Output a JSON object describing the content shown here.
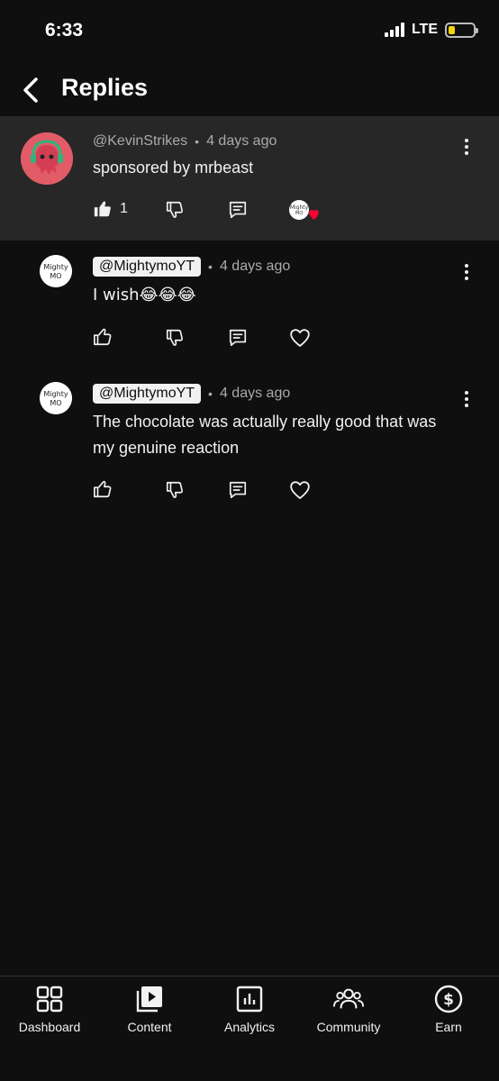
{
  "status_bar": {
    "time": "6:33",
    "network": "LTE",
    "battery_level": 0.25,
    "battery_color": "#f5d30f"
  },
  "header": {
    "back_icon": "chevron-left-icon",
    "title": "Replies"
  },
  "parent_comment": {
    "handle": "@KevinStrikes",
    "separator": "•",
    "time": "4 days ago",
    "text": "sponsored by mrbeast",
    "like_count": "1",
    "liked": true,
    "creator_heart": true
  },
  "replies": [
    {
      "handle": "@MightymoYT",
      "separator": "•",
      "time": "4 days ago",
      "text": "I wish😂😂😂",
      "avatar_text": "Mighty MO"
    },
    {
      "handle": "@MightymoYT",
      "separator": "•",
      "time": "4 days ago",
      "text": "The chocolate was actually really good that was my genuine reaction",
      "avatar_text": "Mighty MO"
    }
  ],
  "bottom_nav": {
    "items": [
      {
        "label": "Dashboard",
        "icon": "dashboard-icon"
      },
      {
        "label": "Content",
        "icon": "content-icon"
      },
      {
        "label": "Analytics",
        "icon": "analytics-icon"
      },
      {
        "label": "Community",
        "icon": "community-icon"
      },
      {
        "label": "Earn",
        "icon": "earn-icon"
      }
    ]
  },
  "colors": {
    "background": "#0f0f0f",
    "parent_highlight": "#272727",
    "text_primary": "#f1f1f1",
    "text_secondary": "#aaaaaa",
    "heart_red": "#ff0033"
  }
}
